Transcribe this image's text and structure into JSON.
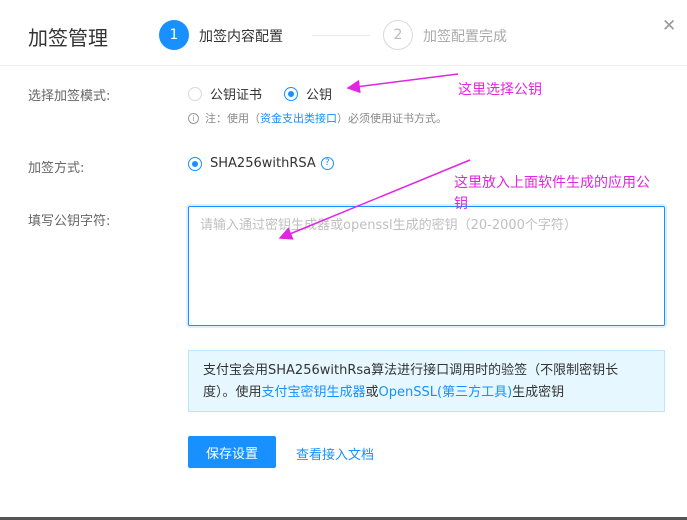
{
  "dialog": {
    "title": "加签管理",
    "close_symbol": "✕",
    "steps": [
      {
        "number": "1",
        "label": "加签内容配置"
      },
      {
        "number": "2",
        "label": "加签配置完成"
      }
    ]
  },
  "form": {
    "mode": {
      "label": "选择加签模式:",
      "options": [
        "公钥证书",
        "公钥"
      ],
      "selected": "公钥"
    },
    "note": {
      "prefix": "注：使用（",
      "link": "资金支出类接口",
      "suffix": "）必须使用证书方式。"
    },
    "method": {
      "label": "加签方式:",
      "value": "SHA256withRSA",
      "help_symbol": "?"
    },
    "key_input": {
      "label": "填写公钥字符:",
      "placeholder": "请输入通过密钥生成器或openssl生成的密钥（20-2000个字符）",
      "value": ""
    },
    "info": {
      "text1": "支付宝会用SHA256withRsa算法进行接口调用时的验签（不限制密钥长度）。使用",
      "link1": "支付宝密钥生成器",
      "text2": "或",
      "link2": "OpenSSL(第三方工具)",
      "text3": "生成密钥"
    },
    "save_button": "保存设置",
    "doc_link": "查看接入文档"
  },
  "annotations": {
    "a1": "这里选择公钥",
    "a2_line1": "这里放入上面软件生成的应用公",
    "a2_line2": "钥",
    "color": "#e026e0"
  },
  "colors": {
    "accent": "#1890ff",
    "info_bg": "#e6f7ff"
  }
}
